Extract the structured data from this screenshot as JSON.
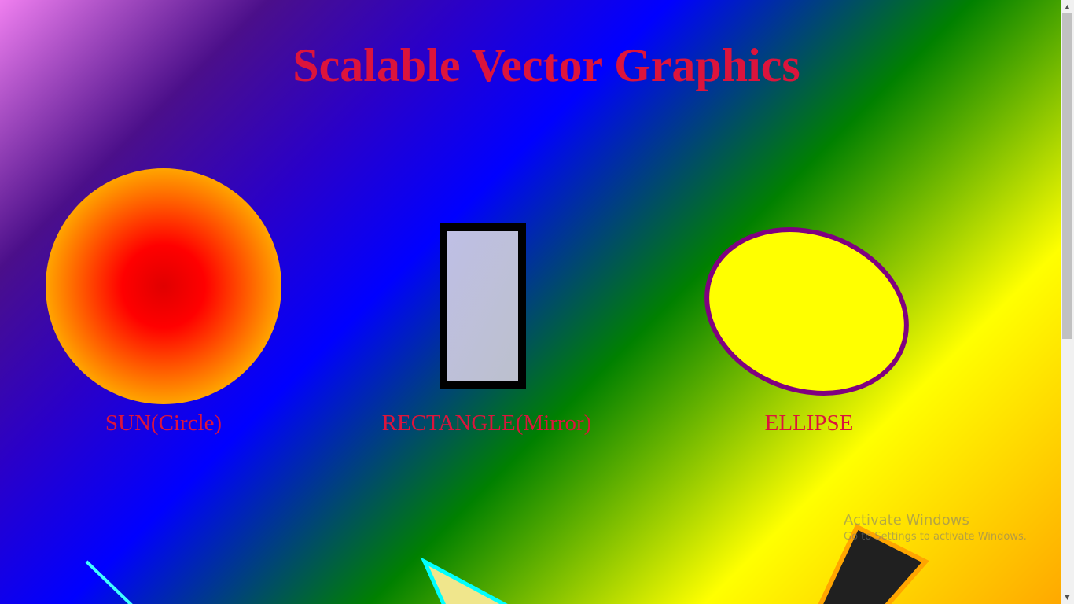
{
  "page": {
    "title": "Scalable Vector Graphics"
  },
  "shapes": [
    {
      "caption": "SUN(Circle)"
    },
    {
      "caption": "RECTANGLE(Mirror)"
    },
    {
      "caption": "ELLIPSE"
    }
  ],
  "colors": {
    "title": "#dc143c",
    "sun_center": "#ff0000",
    "sun_edge": "#ffa500",
    "rect_stroke": "#000000",
    "rect_fill": "#c0c0e0",
    "ellipse_fill": "#ffff00",
    "ellipse_stroke": "#800080",
    "line_stroke": "#40ffff",
    "polygon_fill": "#f0e68c",
    "polygon_stroke": "#00ffff",
    "dark_polygon_fill": "#202020",
    "dark_polygon_stroke": "#ffa500"
  },
  "watermark": {
    "title": "Activate Windows",
    "subtitle": "Go to Settings to activate Windows."
  }
}
